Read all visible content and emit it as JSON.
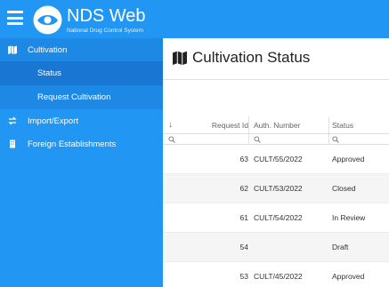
{
  "app": {
    "name": "NDS Web",
    "subtitle": "National Drug Control System"
  },
  "sidebar": {
    "items": [
      {
        "label": "Cultivation",
        "icon": "map-icon"
      },
      {
        "label": "Status"
      },
      {
        "label": "Request Cultivation"
      },
      {
        "label": "Import/Export",
        "icon": "exchange-icon"
      },
      {
        "label": "Foreign Establishments",
        "icon": "building-icon"
      }
    ]
  },
  "main": {
    "title": "Cultivation Status",
    "title_icon": "map-icon"
  },
  "grid": {
    "sort_icon": "↓",
    "columns": [
      "Request Id",
      "Auth. Number",
      "Status"
    ],
    "rows": [
      {
        "request_id": "63",
        "auth_number": "CULT/55/2022",
        "status": "Approved"
      },
      {
        "request_id": "62",
        "auth_number": "CULT/53/2022",
        "status": "Closed"
      },
      {
        "request_id": "61",
        "auth_number": "CULT/54/2022",
        "status": "In Review"
      },
      {
        "request_id": "54",
        "auth_number": "",
        "status": "Draft"
      },
      {
        "request_id": "53",
        "auth_number": "CULT/45/2022",
        "status": "Approved"
      }
    ]
  },
  "colors": {
    "primary": "#2196f3",
    "sidebar_active": "#1976d2",
    "sidebar_sub": "#1e88e5"
  }
}
